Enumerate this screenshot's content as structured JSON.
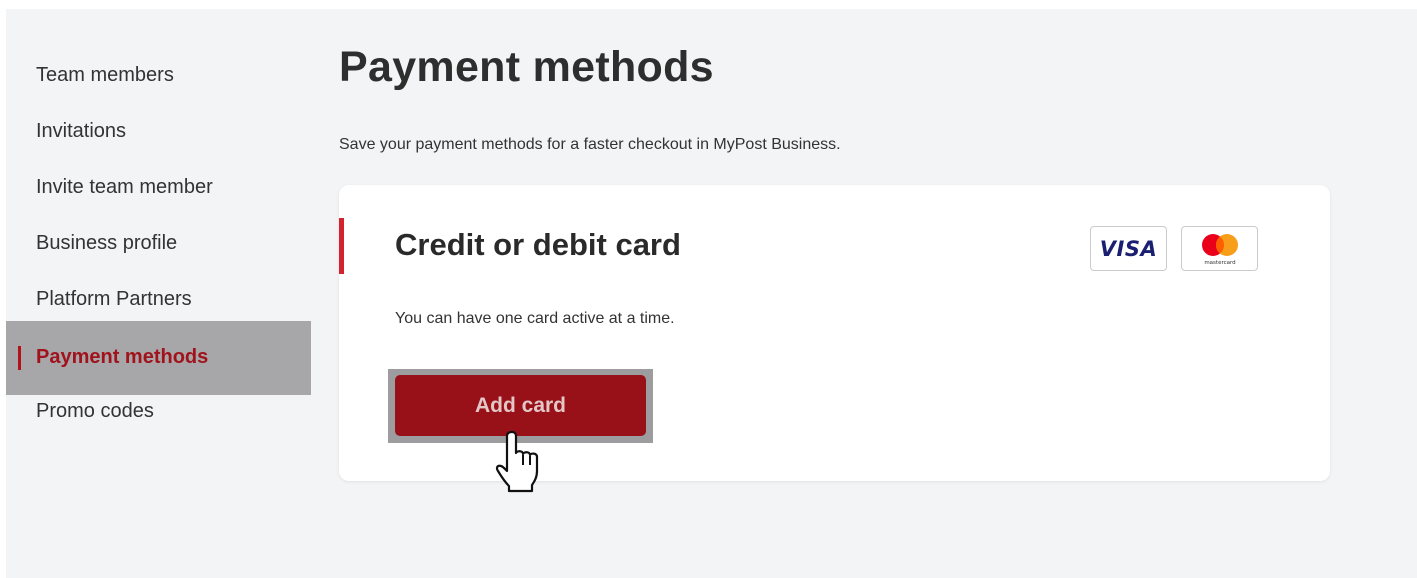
{
  "sidebar": {
    "items": [
      {
        "label": "Team members"
      },
      {
        "label": "Invitations"
      },
      {
        "label": "Invite team member"
      },
      {
        "label": "Business profile"
      },
      {
        "label": "Platform Partners"
      },
      {
        "label": "Payment methods",
        "active": true
      },
      {
        "label": "Promo codes"
      }
    ]
  },
  "main": {
    "title": "Payment methods",
    "description": "Save your payment methods for a faster checkout in MyPost Business.",
    "card": {
      "title": "Credit or debit card",
      "description": "You can have one card active at a time.",
      "button_label": "Add card",
      "logos": {
        "visa": {
          "text": "VISA",
          "icon": "visa-logo"
        },
        "mastercard": {
          "text": "mastercard",
          "icon": "mastercard-logo"
        }
      }
    }
  },
  "colors": {
    "accent": "#d2232f",
    "button": "#981018",
    "active_nav_text": "#a1131c",
    "active_nav_bg": "#a7a7a9",
    "page_bg": "#f3f4f5"
  },
  "cursor": {
    "icon": "hand-pointer-icon"
  }
}
